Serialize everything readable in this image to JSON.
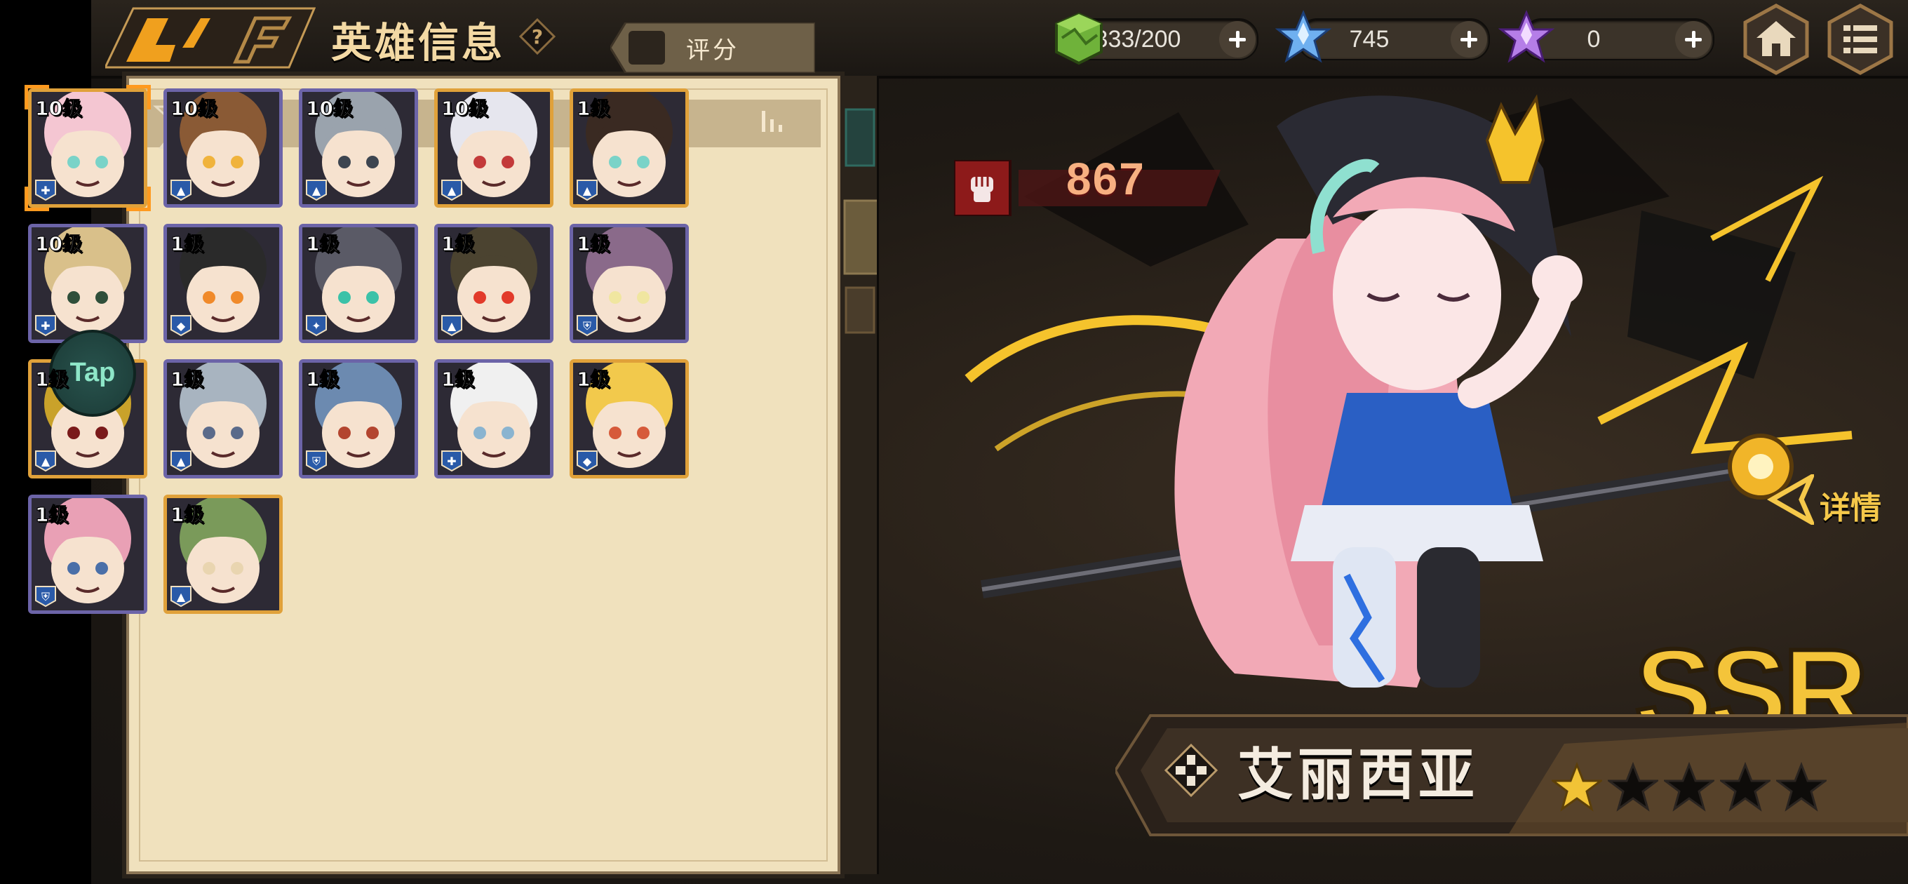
{
  "header": {
    "title": "英雄信息",
    "help_icon": "help-icon",
    "resources": [
      {
        "icon": "stamina-cube-icon",
        "value": "333/200"
      },
      {
        "icon": "blue-crystal-icon",
        "value": "745"
      },
      {
        "icon": "purple-crystal-icon",
        "value": "0"
      }
    ],
    "home_icon": "home-icon",
    "menu_icon": "menu-icon"
  },
  "filter": {
    "filter_icon": "filter-icon",
    "sort_label": "评分",
    "sort_icon": "sort-bars-icon"
  },
  "heroes": [
    {
      "level": "10级",
      "selected": true,
      "class": "support",
      "frame": "orange"
    },
    {
      "level": "10级",
      "selected": false,
      "class": "warrior",
      "frame": "purple"
    },
    {
      "level": "10级",
      "selected": false,
      "class": "warrior",
      "frame": "purple"
    },
    {
      "level": "10级",
      "selected": false,
      "class": "warrior",
      "frame": "orange"
    },
    {
      "level": "1级",
      "selected": false,
      "class": "warrior",
      "frame": "orange"
    },
    {
      "level": "10级",
      "selected": false,
      "class": "support",
      "frame": "purple"
    },
    {
      "level": "1级",
      "selected": false,
      "class": "mage",
      "frame": "purple"
    },
    {
      "level": "1级",
      "selected": false,
      "class": "assassin",
      "frame": "purple"
    },
    {
      "level": "1级",
      "selected": false,
      "class": "warrior",
      "frame": "purple"
    },
    {
      "level": "1级",
      "selected": false,
      "class": "tank",
      "frame": "purple"
    },
    {
      "level": "1级",
      "selected": false,
      "class": "warrior",
      "frame": "orange"
    },
    {
      "level": "1级",
      "selected": false,
      "class": "warrior",
      "frame": "purple"
    },
    {
      "level": "1级",
      "selected": false,
      "class": "tank",
      "frame": "purple"
    },
    {
      "level": "1级",
      "selected": false,
      "class": "support",
      "frame": "purple"
    },
    {
      "level": "1级",
      "selected": false,
      "class": "mage",
      "frame": "orange"
    },
    {
      "level": "1级",
      "selected": false,
      "class": "tank",
      "frame": "purple"
    },
    {
      "level": "1级",
      "selected": false,
      "class": "warrior",
      "frame": "orange"
    }
  ],
  "hero_detail": {
    "power_icon": "fist-icon",
    "power": "867",
    "detail_label": "详情",
    "rarity": "SSR",
    "name": "艾丽西亚",
    "class_icon": "support-cross-icon",
    "stars_filled": 1,
    "stars_total": 5
  },
  "overlay": {
    "tap_label": "Tap"
  },
  "colors": {
    "panel": "#f0e1bd",
    "gold": "#f4c43a",
    "frame_orange": "#e0a13a",
    "frame_purple": "#6c64a8",
    "selection": "#ff9a1f"
  }
}
